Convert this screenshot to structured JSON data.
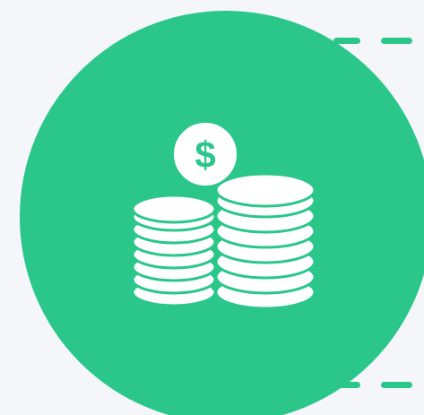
{
  "graphic": {
    "icon": "coin-stack-icon",
    "currency_symbol": "$",
    "colors": {
      "background": "#f4f6fa",
      "accent": "#2bc78a",
      "icon_fill": "#ffffff"
    }
  }
}
